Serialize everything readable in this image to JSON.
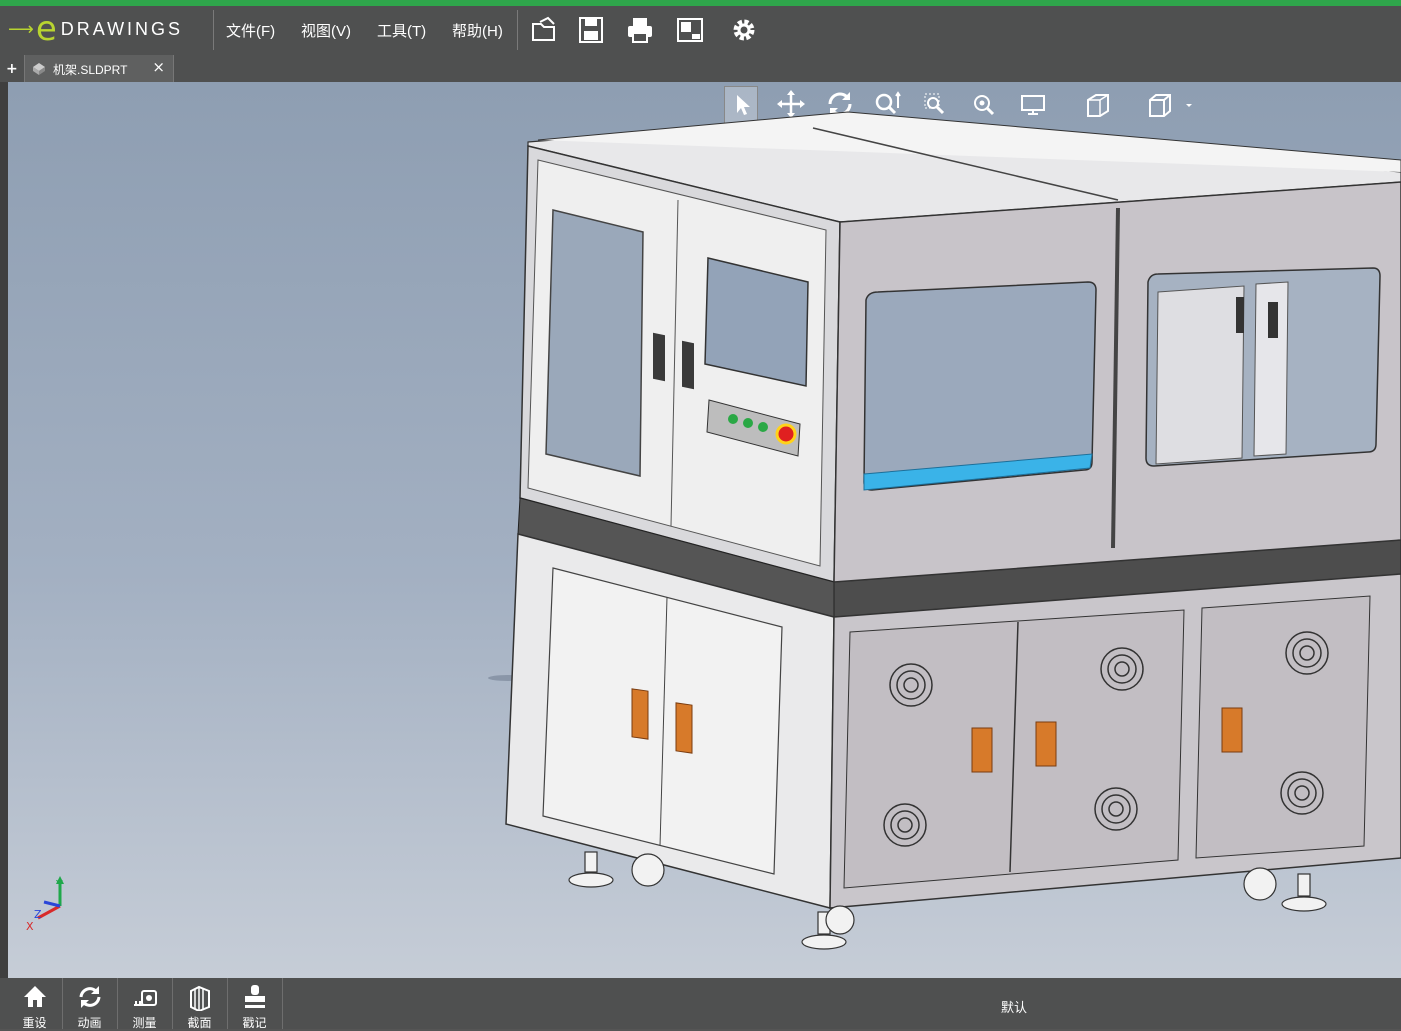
{
  "app": {
    "logo_text": "DRAWINGS",
    "logo_mark": "e"
  },
  "menu": {
    "file": "文件(F)",
    "view": "视图(V)",
    "tools": "工具(T)",
    "help": "帮助(H)"
  },
  "toolbar_icons": [
    "open-icon",
    "save-icon",
    "print-icon",
    "sheet-icon",
    "settings-icon"
  ],
  "tabs": [
    {
      "label": "机架.SLDPRT",
      "close": "×"
    }
  ],
  "tabbar": {
    "add": "+"
  },
  "view_tools": [
    "select-icon",
    "pan-icon",
    "rotate-icon",
    "zoom-icon",
    "zoom-window-icon",
    "zoom-fit-icon",
    "display-style-icon",
    "section-view-icon",
    "view-orientation-icon"
  ],
  "triad": {
    "x": "X",
    "y": "Y",
    "z": "Z"
  },
  "bottom": {
    "buttons": [
      {
        "label": "重设",
        "icon": "home-icon"
      },
      {
        "label": "动画",
        "icon": "animate-icon"
      },
      {
        "label": "测量",
        "icon": "measure-icon"
      },
      {
        "label": "截面",
        "icon": "section-icon"
      },
      {
        "label": "戳记",
        "icon": "stamp-icon"
      }
    ],
    "status": "默认"
  },
  "colors": {
    "accent": "#b8d430",
    "bar": "#4f5050",
    "handle": "#d77a2a",
    "panel_blue": "#3ab3e8"
  }
}
